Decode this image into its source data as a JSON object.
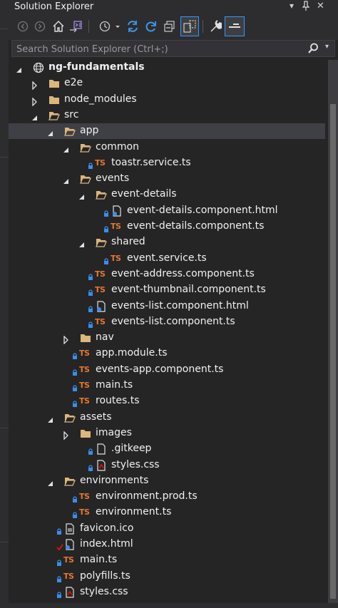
{
  "window": {
    "title": "Solution Explorer"
  },
  "search": {
    "placeholder": "Search Solution Explorer (Ctrl+;)"
  },
  "toolbar": {
    "buttons": [
      "back-icon",
      "forward-icon",
      "home-icon",
      "vs-switch-icon",
      "history-icon",
      "sync-icon",
      "refresh-icon",
      "collapse-all-icon",
      "show-all-files-icon",
      "properties-icon",
      "preview-icon"
    ]
  },
  "tree": {
    "items": [
      {
        "label": "ng-fundamentals",
        "type": "project",
        "arrow": "open",
        "bold": true
      },
      {
        "label": "e2e",
        "type": "folder",
        "arrow": "closed"
      },
      {
        "label": "node_modules",
        "type": "folder",
        "arrow": "closed"
      },
      {
        "label": "src",
        "type": "folder-open",
        "arrow": "open"
      },
      {
        "label": "app",
        "type": "folder-open",
        "arrow": "open",
        "selected": true
      },
      {
        "label": "common",
        "type": "folder-open",
        "arrow": "open"
      },
      {
        "label": "toastr.service.ts",
        "type": "ts",
        "lock": true
      },
      {
        "label": "events",
        "type": "folder-open",
        "arrow": "open"
      },
      {
        "label": "event-details",
        "type": "folder-open",
        "arrow": "open"
      },
      {
        "label": "event-details.component.html",
        "type": "html",
        "lock": true
      },
      {
        "label": "event-details.component.ts",
        "type": "ts",
        "lock": true
      },
      {
        "label": "shared",
        "type": "folder-open",
        "arrow": "open"
      },
      {
        "label": "event.service.ts",
        "type": "ts",
        "lock": true
      },
      {
        "label": "event-address.component.ts",
        "type": "ts",
        "lock": true
      },
      {
        "label": "event-thumbnail.component.ts",
        "type": "ts",
        "lock": true
      },
      {
        "label": "events-list.component.html",
        "type": "html",
        "lock": true
      },
      {
        "label": "events-list.component.ts",
        "type": "ts",
        "lock": true
      },
      {
        "label": "nav",
        "type": "folder",
        "arrow": "closed"
      },
      {
        "label": "app.module.ts",
        "type": "ts",
        "lock": true
      },
      {
        "label": "events-app.component.ts",
        "type": "ts",
        "lock": true
      },
      {
        "label": "main.ts",
        "type": "ts",
        "lock": true
      },
      {
        "label": "routes.ts",
        "type": "ts",
        "lock": true
      },
      {
        "label": "assets",
        "type": "folder-open",
        "arrow": "open"
      },
      {
        "label": "images",
        "type": "folder",
        "arrow": "closed"
      },
      {
        "label": ".gitkeep",
        "type": "file",
        "lock": true
      },
      {
        "label": "styles.css",
        "type": "css",
        "lock": true
      },
      {
        "label": "environments",
        "type": "folder-open",
        "arrow": "open"
      },
      {
        "label": "environment.prod.ts",
        "type": "ts",
        "lock": true
      },
      {
        "label": "environment.ts",
        "type": "ts",
        "lock": true
      },
      {
        "label": "favicon.ico",
        "type": "image",
        "lock": true
      },
      {
        "label": "index.html",
        "type": "html",
        "check": true
      },
      {
        "label": "main.ts",
        "type": "ts",
        "lock": true
      },
      {
        "label": "polyfills.ts",
        "type": "ts",
        "lock": true
      },
      {
        "label": "styles.css",
        "type": "css",
        "lock": true
      }
    ]
  },
  "colors": {
    "background": "#252526",
    "selection": "#3f3f46",
    "folder": "#dcb67a",
    "ts": "#e8762b",
    "lock": "#3c8ee5",
    "check": "#e51400"
  }
}
